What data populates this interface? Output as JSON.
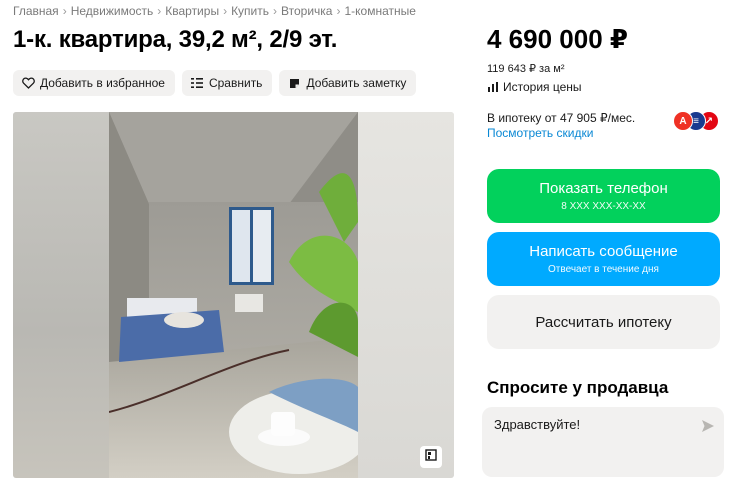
{
  "breadcrumb": [
    "Главная",
    "Недвижимость",
    "Квартиры",
    "Купить",
    "Вторичка",
    "1-комнатные"
  ],
  "title": "1-к. квартира, 39,2 м², 2/9 эт.",
  "actions": {
    "favorite": "Добавить в избранное",
    "compare": "Сравнить",
    "note": "Добавить заметку"
  },
  "price": {
    "value": "4 690 000 ₽",
    "per_m": "119 643 ₽ за м²",
    "history": "История цены"
  },
  "mortgage": {
    "text": "В ипотеку от 47 905 ₽/мес.",
    "discounts": "Посмотреть скидки",
    "banks": [
      {
        "letter": "A",
        "color": "#ef3124"
      },
      {
        "letter": "≡",
        "color": "#1a3a8f"
      },
      {
        "letter": "↗",
        "color": "#e30613"
      }
    ]
  },
  "buttons": {
    "phone": {
      "label": "Показать телефон",
      "sub": "8 XXX XXX-XX-XX"
    },
    "message": {
      "label": "Написать сообщение",
      "sub": "Отвечает в течение дня"
    },
    "calc": {
      "label": "Рассчитать ипотеку"
    }
  },
  "ask": {
    "title": "Спросите у продавца",
    "value": "Здравствуйте!"
  },
  "colors": {
    "green": "#02d15c",
    "blue": "#00aaff",
    "link": "#0a88d4"
  }
}
